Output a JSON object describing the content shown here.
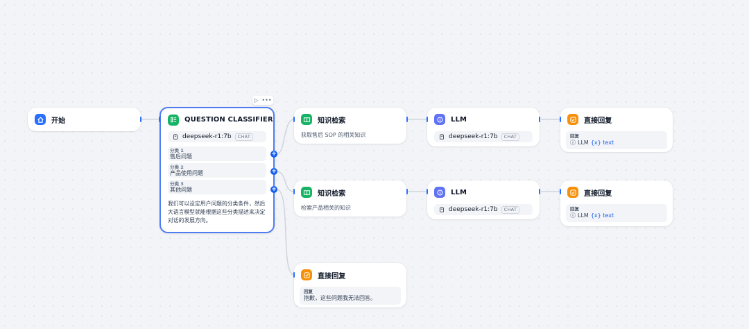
{
  "colors": {
    "start_icon": "#2970ff",
    "classifier_icon": "#16b364",
    "knowledge_icon": "#16b364",
    "llm_icon": "#6172f3",
    "answer_icon": "#f79009",
    "selected_border": "#4d7cf5",
    "edge": "#d0d5dd",
    "handle": "#2970ff"
  },
  "toolbar": {
    "run_icon": "play-icon",
    "more_icon": "more-horizontal-icon"
  },
  "start": {
    "title": "开始",
    "icon": "home-icon"
  },
  "classifier": {
    "title": "QUESTION CLASSIFIER",
    "icon": "classifier-icon",
    "model": "deepseek-r1:7b",
    "model_badge": "CHAT",
    "classes": [
      {
        "label": "分类 1",
        "text": "售后问题"
      },
      {
        "label": "分类 2",
        "text": "产品使用问题"
      },
      {
        "label": "分类 3",
        "text": "其他问题"
      }
    ],
    "description": "我们可以设定用户问题的分类条件，然后大语言模型就能根据这些分类描述来决定对话的发展方向。"
  },
  "branch1": {
    "knowledge": {
      "title": "知识检索",
      "desc": "获取售后 SOP 的相关知识",
      "icon": "book-icon"
    },
    "llm": {
      "title": "LLM",
      "model": "deepseek-r1:7b",
      "badge": "CHAT",
      "icon": "llm-icon"
    },
    "answer": {
      "title": "直接回复",
      "label": "回复",
      "source": "LLM",
      "var": "{x} text",
      "icon": "reply-icon"
    }
  },
  "branch2": {
    "knowledge": {
      "title": "知识检索",
      "desc": "检索产品相关的知识",
      "icon": "book-icon"
    },
    "llm": {
      "title": "LLM",
      "model": "deepseek-r1:7b",
      "badge": "CHAT",
      "icon": "llm-icon"
    },
    "answer": {
      "title": "直接回复",
      "label": "回复",
      "source": "LLM",
      "var": "{x} text",
      "icon": "reply-icon"
    }
  },
  "branch3": {
    "answer": {
      "title": "直接回复",
      "label": "回复",
      "text": "抱歉，这些问题我无法回答。",
      "icon": "reply-icon"
    }
  }
}
